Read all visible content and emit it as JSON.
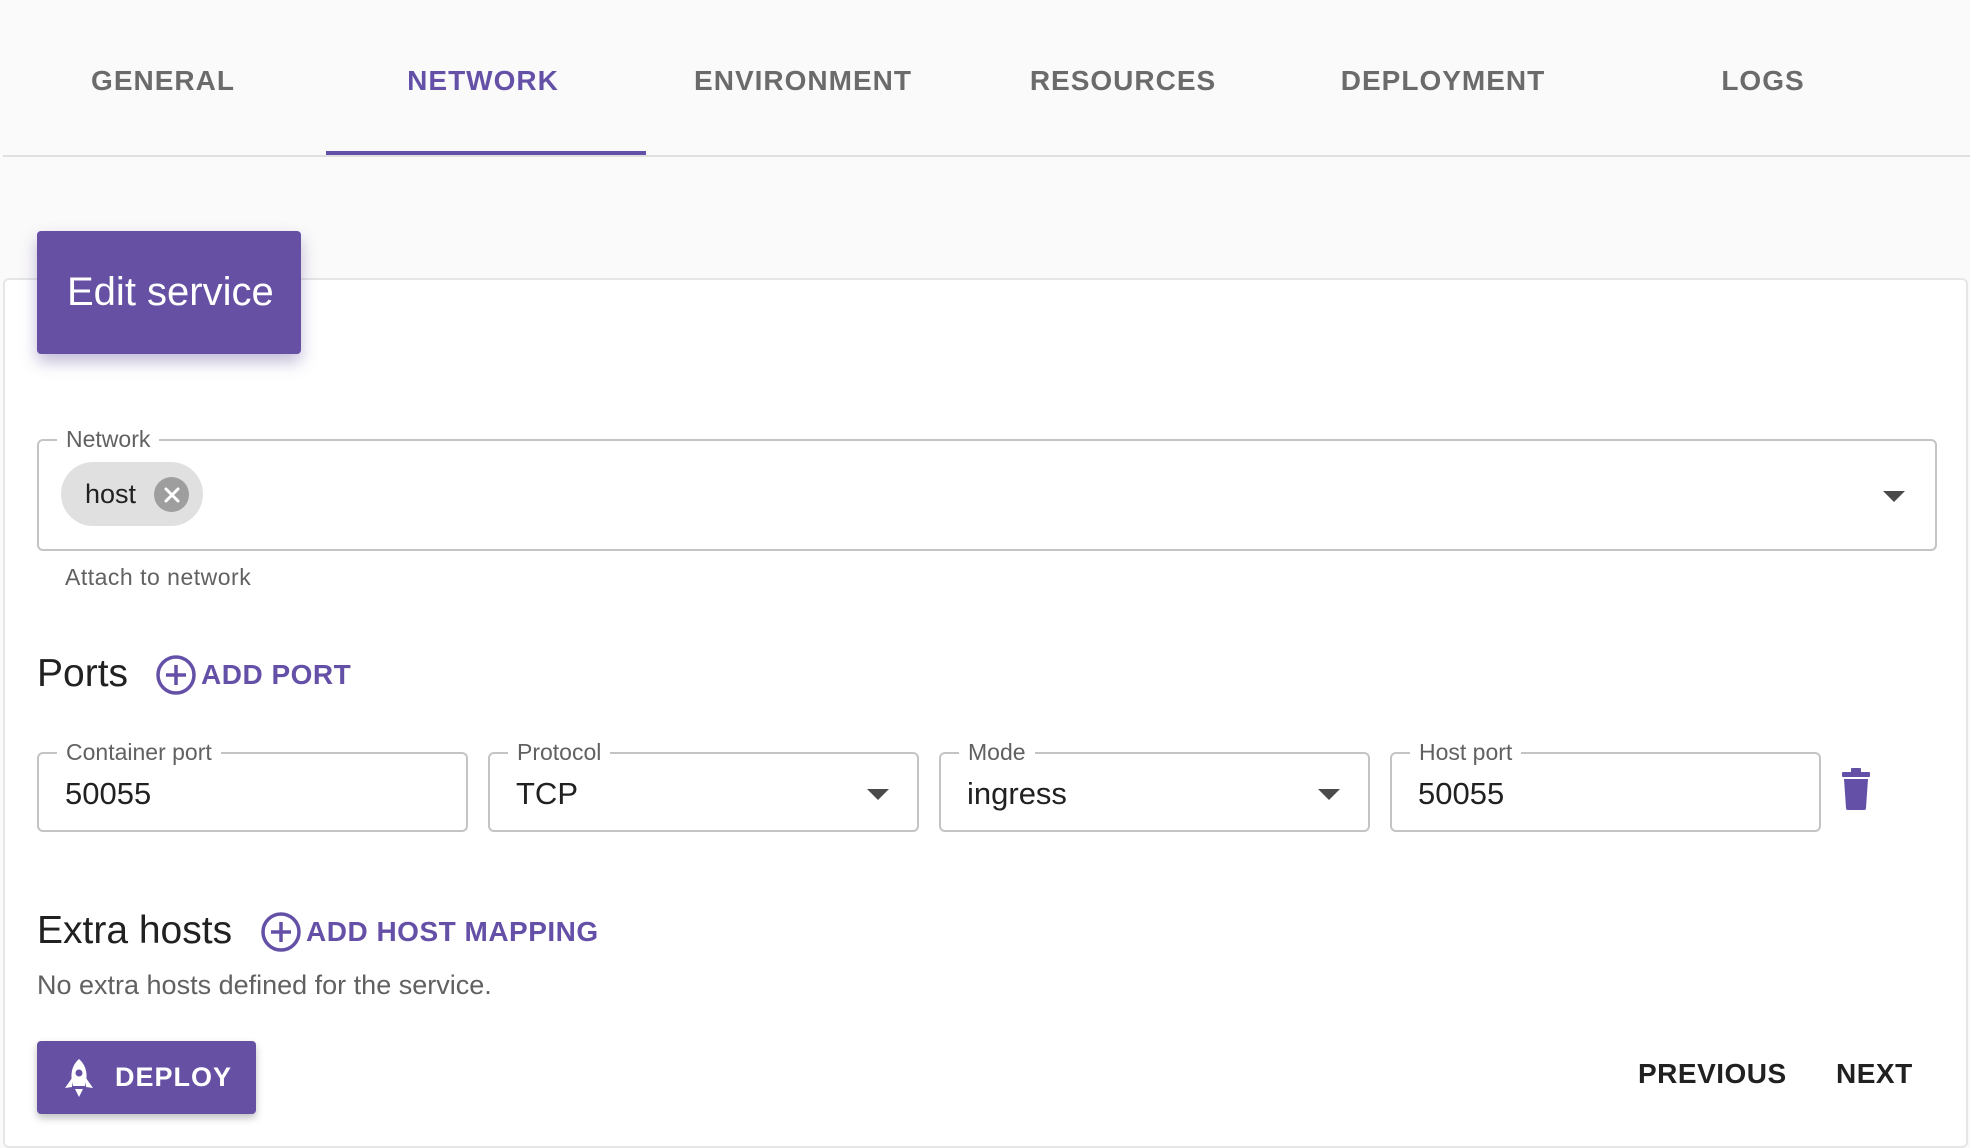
{
  "tabs": [
    {
      "label": "GENERAL"
    },
    {
      "label": "NETWORK"
    },
    {
      "label": "ENVIRONMENT"
    },
    {
      "label": "RESOURCES"
    },
    {
      "label": "DEPLOYMENT"
    },
    {
      "label": "LOGS"
    }
  ],
  "active_tab": "NETWORK",
  "card": {
    "title": "Edit service"
  },
  "network": {
    "label": "Network",
    "chip": "host",
    "helper": "Attach to network"
  },
  "ports": {
    "title": "Ports",
    "add_label": "ADD PORT",
    "container_port": {
      "label": "Container port",
      "value": "50055"
    },
    "protocol": {
      "label": "Protocol",
      "value": "TCP"
    },
    "mode": {
      "label": "Mode",
      "value": "ingress"
    },
    "host_port": {
      "label": "Host port",
      "value": "50055"
    }
  },
  "extra_hosts": {
    "title": "Extra hosts",
    "add_label": "ADD HOST MAPPING",
    "empty_text": "No extra hosts defined for the service."
  },
  "actions": {
    "deploy": "DEPLOY",
    "previous": "PREVIOUS",
    "next": "NEXT"
  },
  "colors": {
    "accent": "#6650a4"
  }
}
